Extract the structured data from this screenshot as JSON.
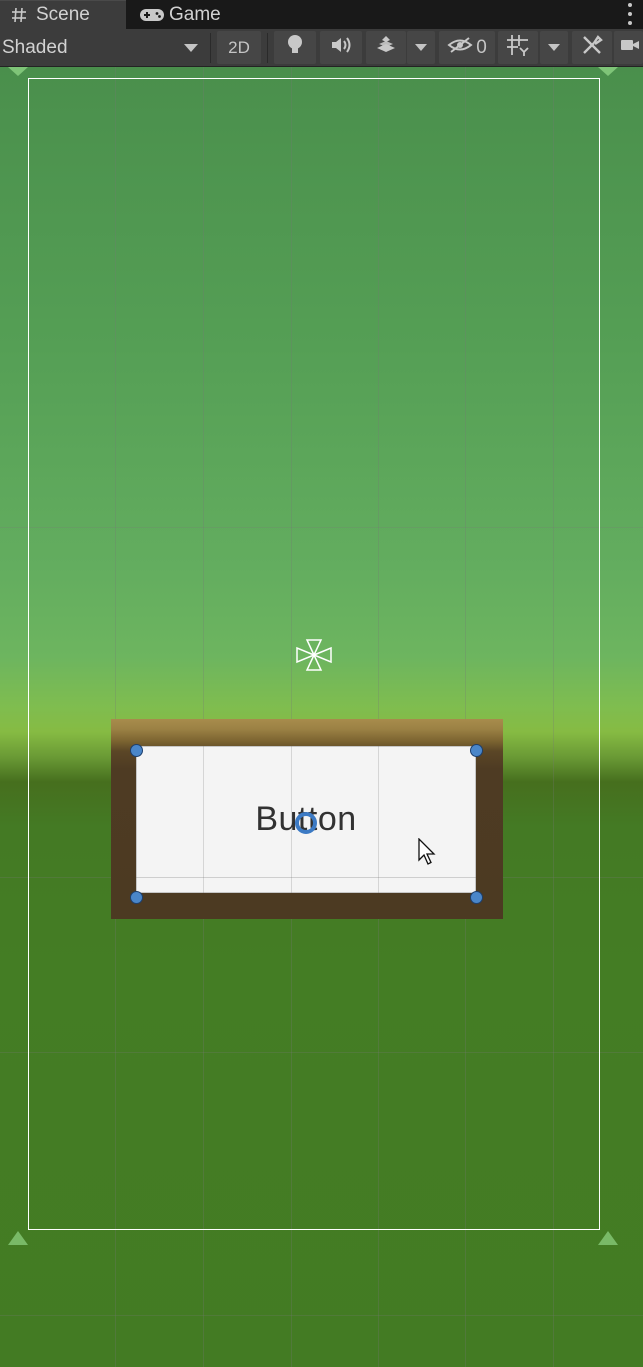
{
  "tabs": {
    "scene_label": "Scene",
    "game_label": "Game"
  },
  "toolbar": {
    "draw_mode": "Shaded",
    "mode_2d": "2D",
    "hidden_count": "0"
  },
  "scene": {
    "button_text": "Button"
  },
  "colors": {
    "selection_handle": "#4a86c9",
    "canvas_frame": "#ffffff",
    "button_face": "#f4f4f4"
  },
  "icons": [
    "grid-icon",
    "gamepad-icon",
    "kebab-menu-icon",
    "lightbulb-icon",
    "audio-icon",
    "effects-icon",
    "hidden-eye-icon",
    "grid-snap-icon",
    "tools-icon",
    "camera-icon",
    "rect-anchor-icon",
    "mouse-cursor-icon"
  ]
}
